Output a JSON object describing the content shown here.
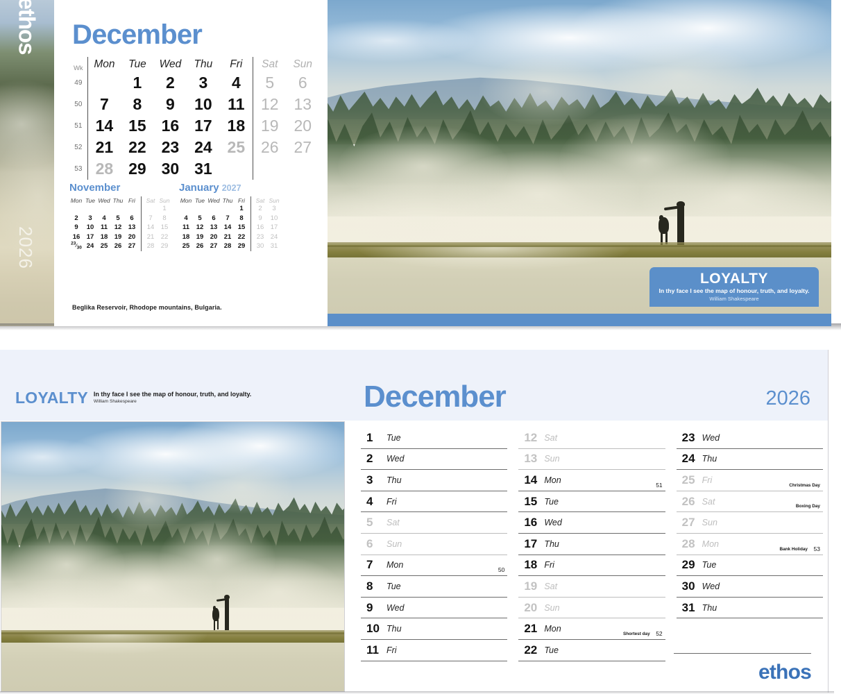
{
  "brand": {
    "logo": "ethos",
    "year": "2026",
    "accent": "#5b8fce",
    "banner_blue": "#5b8fc9"
  },
  "top_panel": {
    "spine": {
      "logo": "ethos",
      "year": "2026"
    },
    "month_title": "December",
    "week_header": "Wk",
    "dow_headers": [
      "Mon",
      "Tue",
      "Wed",
      "Thu",
      "Fri",
      "Sat",
      "Sun"
    ],
    "weeks": [
      {
        "wk": "49",
        "days": [
          "",
          "1",
          "2",
          "3",
          "4",
          "5",
          "6"
        ]
      },
      {
        "wk": "50",
        "days": [
          "7",
          "8",
          "9",
          "10",
          "11",
          "12",
          "13"
        ]
      },
      {
        "wk": "51",
        "days": [
          "14",
          "15",
          "16",
          "17",
          "18",
          "19",
          "20"
        ]
      },
      {
        "wk": "52",
        "days": [
          "21",
          "22",
          "23",
          "24",
          "25",
          "26",
          "27"
        ]
      },
      {
        "wk": "53",
        "days": [
          "28",
          "29",
          "30",
          "31",
          "",
          "",
          ""
        ]
      }
    ],
    "dim_days": [
      "25",
      "28"
    ],
    "mini_prev": {
      "title": "November",
      "year": "",
      "dow_headers": [
        "Mon",
        "Tue",
        "Wed",
        "Thu",
        "Fri",
        "Sat",
        "Sun"
      ],
      "rows": [
        [
          "",
          "",
          "",
          "",
          "",
          "",
          "1"
        ],
        [
          "2",
          "3",
          "4",
          "5",
          "6",
          "7",
          "8"
        ],
        [
          "9",
          "10",
          "11",
          "12",
          "13",
          "14",
          "15"
        ],
        [
          "16",
          "17",
          "18",
          "19",
          "20",
          "21",
          "22"
        ],
        [
          "23/30",
          "24",
          "25",
          "26",
          "27",
          "28",
          "29"
        ]
      ]
    },
    "mini_next": {
      "title": "January",
      "year": "2027",
      "dow_headers": [
        "Mon",
        "Tue",
        "Wed",
        "Thu",
        "Fri",
        "Sat",
        "Sun"
      ],
      "rows": [
        [
          "",
          "",
          "",
          "",
          "1",
          "2",
          "3"
        ],
        [
          "4",
          "5",
          "6",
          "7",
          "8",
          "9",
          "10"
        ],
        [
          "11",
          "12",
          "13",
          "14",
          "15",
          "16",
          "17"
        ],
        [
          "18",
          "19",
          "20",
          "21",
          "22",
          "23",
          "24"
        ],
        [
          "25",
          "26",
          "27",
          "28",
          "29",
          "30",
          "31"
        ]
      ]
    },
    "photo_caption": "Beglika Reservoir, Rhodope mountains, Bulgaria.",
    "banner": {
      "heading": "LOYALTY",
      "quote": "In thy face I see the map of honour, truth, and loyalty.",
      "author": "William Shakespeare"
    }
  },
  "bottom_panel": {
    "banner": {
      "heading": "LOYALTY",
      "quote": "In thy face I see the map of honour, truth, and loyalty.",
      "author": "William Shakespeare"
    },
    "month_title": "December",
    "year": "2026",
    "logo": "ethos",
    "columns": [
      [
        {
          "num": "1",
          "dow": "Tue",
          "note": "",
          "wk": "",
          "weekend": false
        },
        {
          "num": "2",
          "dow": "Wed",
          "note": "",
          "wk": "",
          "weekend": false
        },
        {
          "num": "3",
          "dow": "Thu",
          "note": "",
          "wk": "",
          "weekend": false
        },
        {
          "num": "4",
          "dow": "Fri",
          "note": "",
          "wk": "",
          "weekend": false
        },
        {
          "num": "5",
          "dow": "Sat",
          "note": "",
          "wk": "",
          "weekend": true
        },
        {
          "num": "6",
          "dow": "Sun",
          "note": "",
          "wk": "",
          "weekend": true
        },
        {
          "num": "7",
          "dow": "Mon",
          "note": "",
          "wk": "50",
          "weekend": false
        },
        {
          "num": "8",
          "dow": "Tue",
          "note": "",
          "wk": "",
          "weekend": false
        },
        {
          "num": "9",
          "dow": "Wed",
          "note": "",
          "wk": "",
          "weekend": false
        },
        {
          "num": "10",
          "dow": "Thu",
          "note": "",
          "wk": "",
          "weekend": false
        },
        {
          "num": "11",
          "dow": "Fri",
          "note": "",
          "wk": "",
          "weekend": false
        }
      ],
      [
        {
          "num": "12",
          "dow": "Sat",
          "note": "",
          "wk": "",
          "weekend": true
        },
        {
          "num": "13",
          "dow": "Sun",
          "note": "",
          "wk": "",
          "weekend": true
        },
        {
          "num": "14",
          "dow": "Mon",
          "note": "",
          "wk": "51",
          "weekend": false
        },
        {
          "num": "15",
          "dow": "Tue",
          "note": "",
          "wk": "",
          "weekend": false
        },
        {
          "num": "16",
          "dow": "Wed",
          "note": "",
          "wk": "",
          "weekend": false
        },
        {
          "num": "17",
          "dow": "Thu",
          "note": "",
          "wk": "",
          "weekend": false
        },
        {
          "num": "18",
          "dow": "Fri",
          "note": "",
          "wk": "",
          "weekend": false
        },
        {
          "num": "19",
          "dow": "Sat",
          "note": "",
          "wk": "",
          "weekend": true
        },
        {
          "num": "20",
          "dow": "Sun",
          "note": "",
          "wk": "",
          "weekend": true
        },
        {
          "num": "21",
          "dow": "Mon",
          "note": "Shortest day",
          "wk": "52",
          "weekend": false
        },
        {
          "num": "22",
          "dow": "Tue",
          "note": "",
          "wk": "",
          "weekend": false
        }
      ],
      [
        {
          "num": "23",
          "dow": "Wed",
          "note": "",
          "wk": "",
          "weekend": false
        },
        {
          "num": "24",
          "dow": "Thu",
          "note": "",
          "wk": "",
          "weekend": false
        },
        {
          "num": "25",
          "dow": "Fri",
          "note": "Christmas Day",
          "wk": "",
          "weekend": true
        },
        {
          "num": "26",
          "dow": "Sat",
          "note": "Boxing Day",
          "wk": "",
          "weekend": true
        },
        {
          "num": "27",
          "dow": "Sun",
          "note": "",
          "wk": "",
          "weekend": true
        },
        {
          "num": "28",
          "dow": "Mon",
          "note": "Bank Holiday",
          "wk": "53",
          "weekend": true
        },
        {
          "num": "29",
          "dow": "Tue",
          "note": "",
          "wk": "",
          "weekend": false
        },
        {
          "num": "30",
          "dow": "Wed",
          "note": "",
          "wk": "",
          "weekend": false
        },
        {
          "num": "31",
          "dow": "Thu",
          "note": "",
          "wk": "",
          "weekend": false
        }
      ]
    ]
  },
  "photo": {
    "subject": "misty-forest-lake-with-person-and-dog",
    "caption": "Beglika Reservoir, Rhodope mountains, Bulgaria."
  }
}
